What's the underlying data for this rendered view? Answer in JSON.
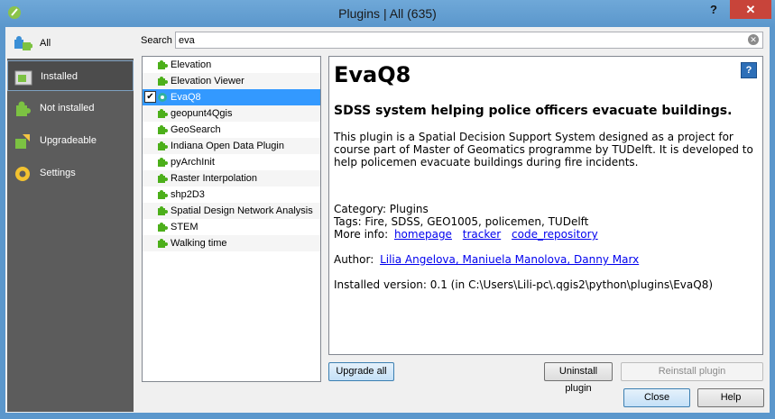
{
  "window": {
    "title": "Plugins | All (635)",
    "help_glyph": "?",
    "close_glyph": "✕"
  },
  "sidebar": {
    "items": [
      {
        "label": "All",
        "icon": "puzzle-icon"
      },
      {
        "label": "Installed",
        "icon": "installed-plugin-icon"
      },
      {
        "label": "Not installed",
        "icon": "puzzle-icon"
      },
      {
        "label": "Upgradeable",
        "icon": "upgrade-icon"
      },
      {
        "label": "Settings",
        "icon": "gear-icon"
      }
    ]
  },
  "search": {
    "label": "Search",
    "value": "eva"
  },
  "plugins": [
    {
      "name": "Elevation"
    },
    {
      "name": "Elevation Viewer"
    },
    {
      "name": "EvaQ8",
      "selected": true,
      "checked": true
    },
    {
      "name": "geopunt4Qgis"
    },
    {
      "name": "GeoSearch"
    },
    {
      "name": "Indiana Open Data Plugin"
    },
    {
      "name": "pyArchInit"
    },
    {
      "name": "Raster Interpolation"
    },
    {
      "name": "shp2D3"
    },
    {
      "name": "Spatial Design Network Analysis"
    },
    {
      "name": "STEM"
    },
    {
      "name": "Walking time"
    }
  ],
  "details": {
    "help_glyph": "?",
    "title": "EvaQ8",
    "subtitle": "SDSS system helping police officers evacuate buildings.",
    "description": "This plugin is a Spatial Decision Support System designed as a project for course part of Master of Geomatics programme by TUDelft. It is developed to help policemen evacuate buildings during fire incidents.",
    "category": "Category: Plugins",
    "tags": "Tags: Fire, SDSS, GEO1005, policemen, TUDelft",
    "more_info_label": "More info:",
    "links": [
      "homepage",
      "tracker",
      "code_repository"
    ],
    "author_label": "Author:",
    "authors": "Lilia Angelova, Maniuela Manolova, Danny Marx",
    "installed_version": "Installed version: 0.1 (in C:\\Users\\Lili-pc\\.qgis2\\python\\plugins\\EvaQ8)"
  },
  "buttons": {
    "upgrade_all": "Upgrade all",
    "uninstall": "Uninstall plugin",
    "reinstall": "Reinstall plugin",
    "close": "Close",
    "help": "Help"
  },
  "colors": {
    "titlebar": "#5b97cc",
    "sidebar": "#5c5c5c",
    "selection": "#3399ff",
    "link": "#0000ee",
    "plugin_icon": "#4caf1a"
  }
}
